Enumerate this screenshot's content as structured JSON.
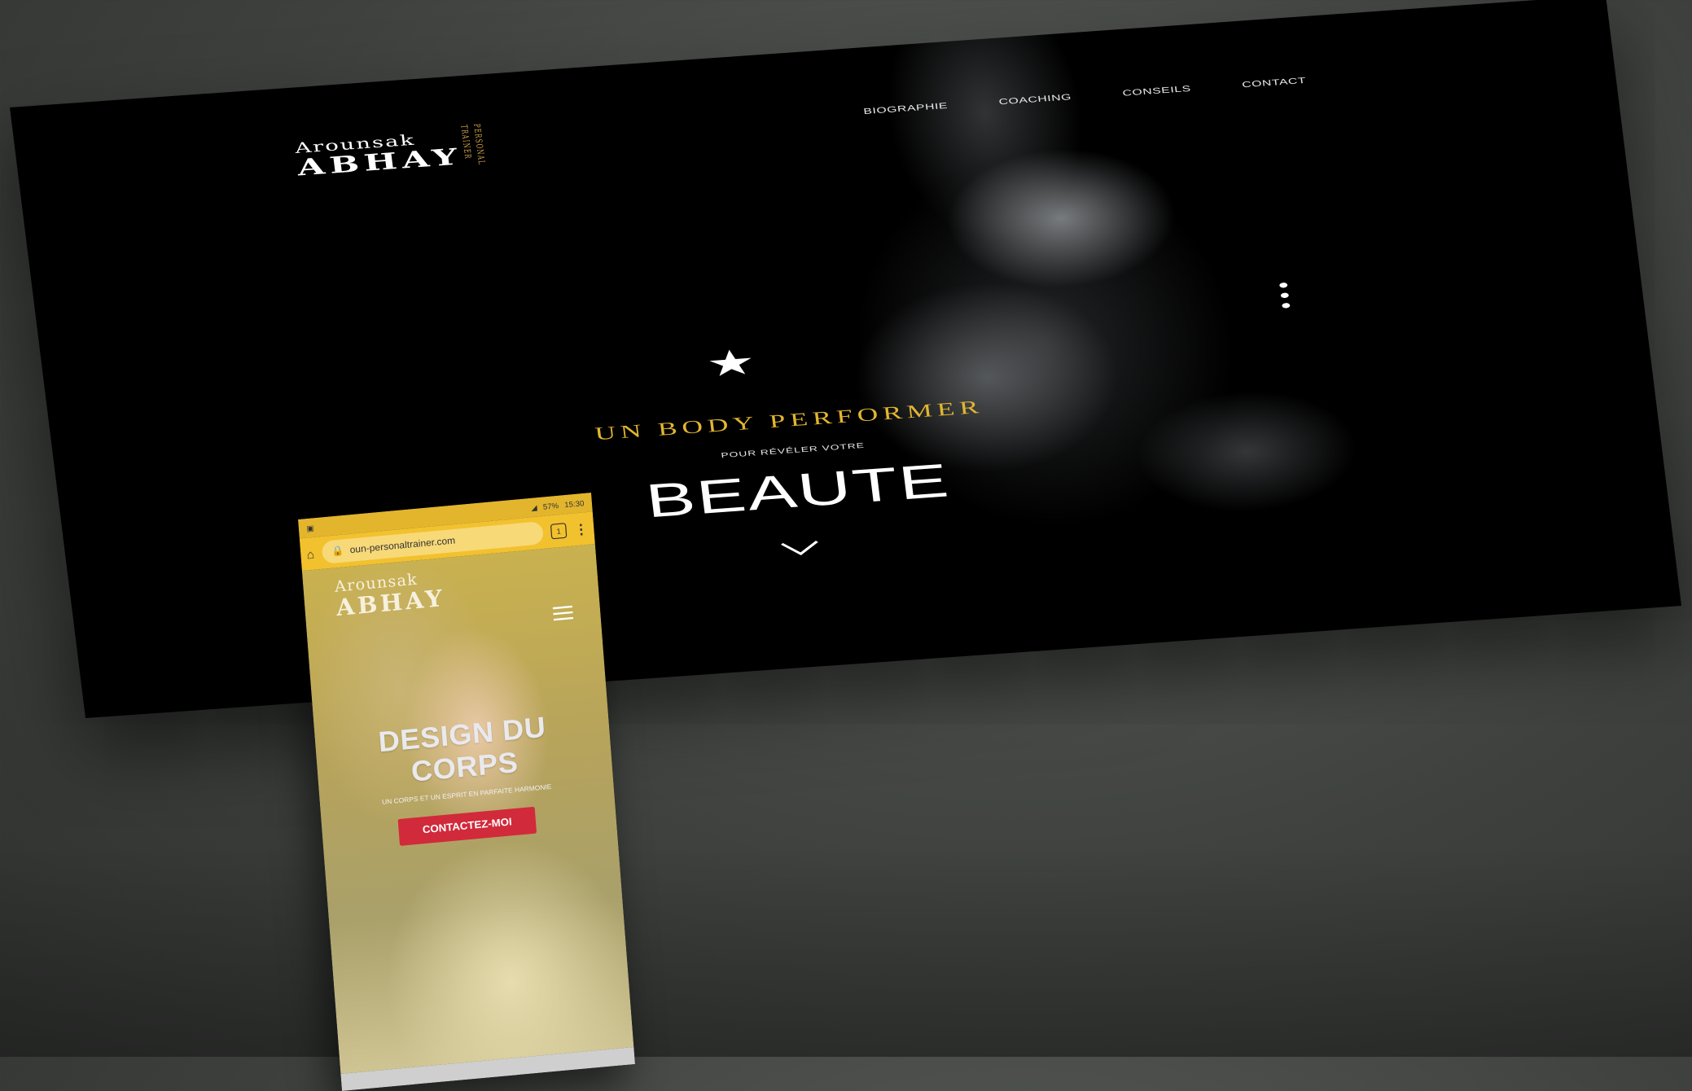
{
  "desktop": {
    "logo": {
      "line1": "Arounsak",
      "line2": "ABHAY",
      "tagline": "PERSONAL TRAINER"
    },
    "nav": [
      "BIOGRAPHIE",
      "COACHING",
      "CONSEILS",
      "CONTACT"
    ],
    "hero": {
      "headline": "UN BODY PERFORMER",
      "subtitle": "POUR RÉVÉLER VOTRE",
      "big_word": "BEAUTE"
    },
    "slider_dots": 3
  },
  "phone": {
    "status": {
      "battery": "57%",
      "time": "15:30"
    },
    "url": "oun-personaltrainer.com",
    "tab_count": "1",
    "logo": {
      "line1": "Arounsak",
      "line2": "ABHAY"
    },
    "hero": {
      "title_line1": "DESIGN DU",
      "title_line2": "CORPS",
      "subtitle": "UN CORPS ET UN ESPRIT EN PARFAITE HARMONIE",
      "cta": "CONTACTEZ-MOI"
    }
  },
  "colors": {
    "accent_gold": "#e2b531",
    "cta_red": "#d12a3b",
    "browser_yellow": "#f2c12e"
  }
}
